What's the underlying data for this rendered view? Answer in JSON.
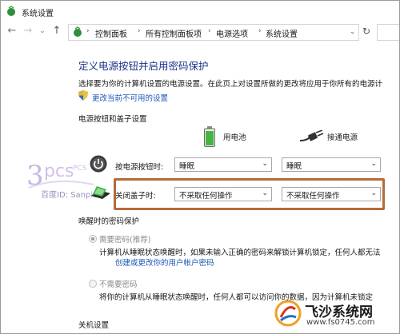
{
  "window": {
    "title": "系统设置"
  },
  "nav": {
    "back": "←",
    "forward": "→",
    "recent": "⌄",
    "up": "↑",
    "refresh": "↻",
    "breadcrumbs": [
      "控制面板",
      "所有控制面板项",
      "电源选项",
      "系统设置"
    ]
  },
  "main": {
    "heading": "定义电源按钮并启用密码保护",
    "description": "选择要为你的计算机设置的电源设置。在此页上对设置所做的更改将应用于你所有的电源计",
    "change_link": "更改当前不可用的设置",
    "section_power": "电源按钮和盖子设置",
    "col_battery": "用电池",
    "col_plugged": "接通电源",
    "rows": [
      {
        "label": "按电源按钮时:",
        "battery": "睡眠",
        "plugged": "睡眠"
      },
      {
        "label": "关闭盖子时:",
        "battery": "不采取任何操作",
        "plugged": "不采取任何操作"
      }
    ],
    "section_password": "唤醒时的密码保护",
    "options": [
      {
        "label": "需要密码(推荐)",
        "desc": "计算机从睡眠状态唤醒时，如果未输入正确的密码来解锁计算机锁定，任何人都无法",
        "link": "创建或更改你的用户帐户密码",
        "checked": true
      },
      {
        "label": "不需要密码",
        "desc": "将你的计算机从睡眠状态唤醒时，任何人都可以访问你的数据，因为计算机未锁定",
        "checked": false
      }
    ],
    "section_shutdown": "关机设置"
  },
  "watermark": {
    "text": "百度ID: Sanpitt"
  },
  "brand": {
    "name": "飞沙系统网",
    "url": "www.fs0745.com"
  }
}
